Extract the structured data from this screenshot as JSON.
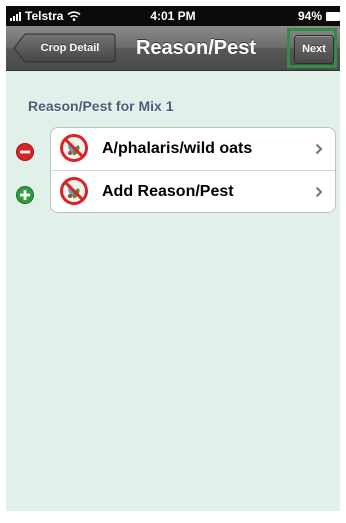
{
  "status_bar": {
    "carrier": "Telstra",
    "time": "4:01 PM",
    "battery": "94%"
  },
  "nav_bar": {
    "back_label": "Crop Detail",
    "title": "Reason/Pest",
    "next_label": "Next"
  },
  "section": {
    "header": "Reason/Pest for Mix 1"
  },
  "rows": [
    {
      "label": "A/phalaris/wild oats",
      "control": "delete-icon",
      "icon": "no-pest-icon"
    },
    {
      "label": "Add Reason/Pest",
      "control": "add-icon",
      "icon": "no-pest-icon"
    }
  ],
  "colors": {
    "content_background": "#e1f1ea",
    "delete": "#d9252a",
    "add": "#2f9e3f",
    "highlight": "#2f8f46",
    "prohibition": "#d6242b"
  }
}
